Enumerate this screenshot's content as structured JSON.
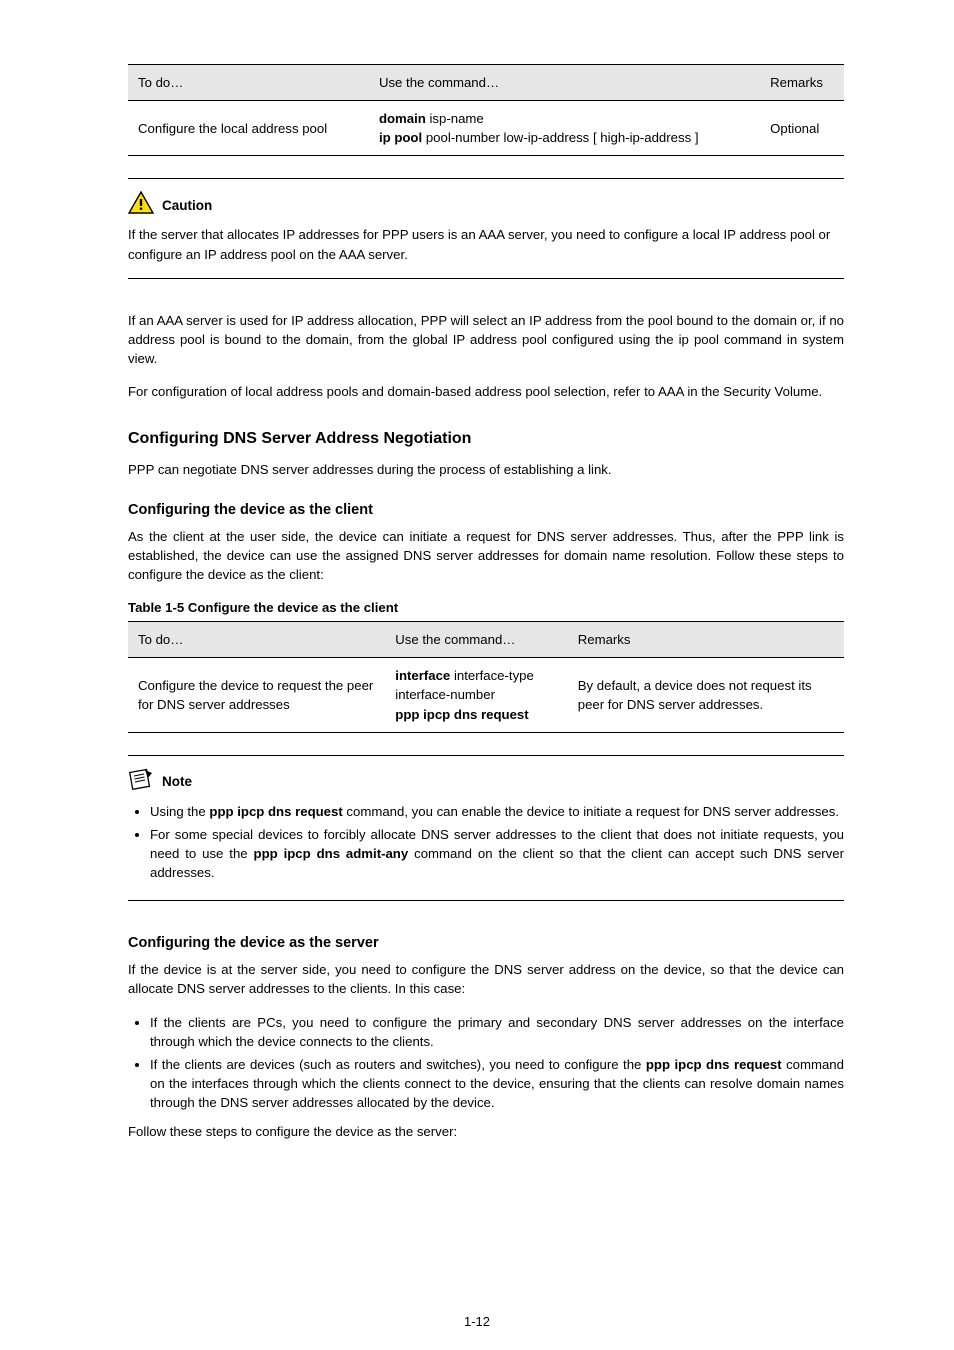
{
  "table4": {
    "headers": [
      "To do…",
      "Use the command…",
      "Remarks"
    ],
    "row": {
      "to": "Configure the local address pool",
      "cmd_markup": "<span class='mono'>domain</span> <span>isp-name</span>",
      "cmd_plain": "domain isp-name",
      "cmd_line2_markup": "<span class='mono'>ip pool</span> <span>pool-number low-ip-address</span> [ <span>high-ip-address</span> ]",
      "cmd_line2_plain": "ip pool pool-number low-ip-address [ high-ip-address ]",
      "remarks": "Optional"
    }
  },
  "caution": {
    "label": "Caution",
    "text": "If the server that allocates IP addresses for PPP users is an AAA server, you need to configure a local IP address pool or configure an IP address pool on the AAA server."
  },
  "para1": "If an AAA server is used for IP address allocation, PPP will select an IP address from the pool bound to the domain or, if no address pool is bound to the domain, from the global IP address pool configured using the ip pool command in system view.",
  "para2": "For configuration of local address pools and domain-based address pool selection, refer to AAA in the Security Volume.",
  "section": "Configuring DNS Server Address Negotiation",
  "section_intro": "PPP can negotiate DNS server addresses during the process of establishing a link.",
  "sub1": {
    "title": "Configuring the device as the client",
    "para": "As the client at the user side, the device can initiate a request for DNS server addresses. Thus, after the PPP link is established, the device can use the assigned DNS server addresses for domain name resolution. Follow these steps to configure the device as the client:"
  },
  "table5": {
    "caption": "Table 1-5 Configure the device as the client",
    "headers": [
      "To do…",
      "Use the command…",
      "Remarks"
    ],
    "row": {
      "to": "Configure the device to request the peer for DNS server addresses",
      "cmd_line1_markup": "<span class='mono'>interface</span> <span>interface-type interface-number</span>",
      "cmd_line1_plain": "interface interface-type interface-number",
      "cmd_line2_markup": "<span class='mono'>ppp ipcp dns request</span>",
      "cmd_line2_plain": "ppp ipcp dns request",
      "remarks": "By default, a device does not request its peer for DNS server addresses."
    }
  },
  "note": {
    "label": "Note",
    "bullets": [
      {
        "markup": "Using the <span class='mono'>ppp ipcp dns request</span> command, you can enable the device to initiate a request for DNS server addresses.",
        "plain": "Using the ppp ipcp dns request command, you can enable the device to initiate a request for DNS server addresses."
      },
      {
        "markup": "For some special devices to forcibly allocate DNS server addresses to the client that does not initiate requests, you need to use the <span class='mono'>ppp ipcp dns admit-any</span> command on the client so that the client can accept such DNS server addresses.",
        "plain": "For some special devices to forcibly allocate DNS server addresses to the client that does not initiate requests, you need to use the ppp ipcp dns admit-any command on the client so that the client can accept such DNS server addresses."
      }
    ]
  },
  "sub2": {
    "title": "Configuring the device as the server",
    "para": "If the device is at the server side, you need to configure the DNS server address on the device, so that the device can allocate DNS server addresses to the clients. In this case:",
    "bullets": [
      "If the clients are PCs, you need to configure the primary and secondary DNS server addresses on the interface through which the device connects to the clients.",
      {
        "markup": "If the clients are devices (such as routers and switches), you need to configure the <span class='mono'>ppp ipcp dns request</span> command on the interfaces through which the clients connect to the device, ensuring that the clients can resolve domain names through the DNS server addresses allocated by the device.",
        "plain": "If the clients are devices (such as routers and switches), you need to configure the ppp ipcp dns request command on the interfaces through which the clients connect to the device, ensuring that the clients can resolve domain names through the DNS server addresses allocated by the device."
      }
    ],
    "closing": "Follow these steps to configure the device as the server:"
  },
  "page_number": "1-12"
}
